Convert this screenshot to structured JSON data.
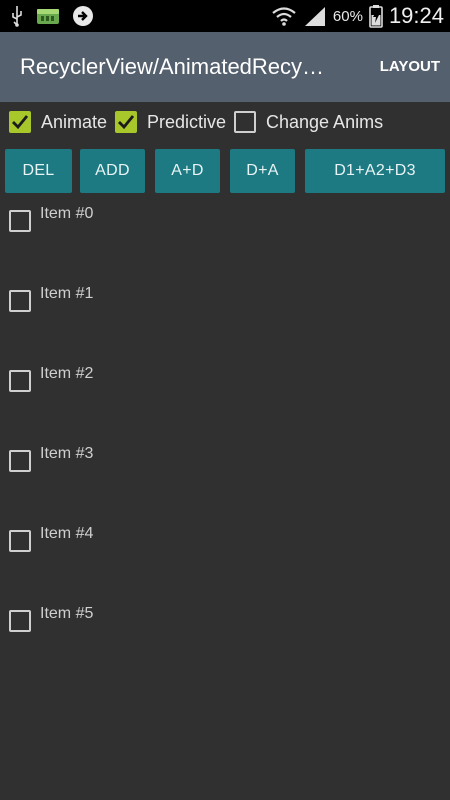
{
  "status_bar": {
    "icons": [
      "usb-icon",
      "battery-app-icon",
      "download-icon",
      "wifi-icon",
      "signal-icon",
      "battery-icon"
    ],
    "battery_percent": "60%",
    "time": "19:24"
  },
  "action_bar": {
    "title": "RecyclerView/AnimatedRecy…",
    "layout_button": "LAYOUT",
    "background": "#55606e"
  },
  "options": [
    {
      "label": "Animate",
      "checked": true
    },
    {
      "label": "Predictive",
      "checked": true
    },
    {
      "label": "Change Anims",
      "checked": false
    }
  ],
  "buttons": [
    {
      "label": "DEL"
    },
    {
      "label": "ADD"
    },
    {
      "label": "A+D"
    },
    {
      "label": "D+A"
    },
    {
      "label": "D1+A2+D3"
    }
  ],
  "items": [
    {
      "label": "Item #0",
      "checked": false
    },
    {
      "label": "Item #1",
      "checked": false
    },
    {
      "label": "Item #2",
      "checked": false
    },
    {
      "label": "Item #3",
      "checked": false
    },
    {
      "label": "Item #4",
      "checked": false
    },
    {
      "label": "Item #5",
      "checked": false
    }
  ],
  "colors": {
    "accent_check": "#a7c72b",
    "button": "#1d7a82",
    "background": "#303030"
  }
}
